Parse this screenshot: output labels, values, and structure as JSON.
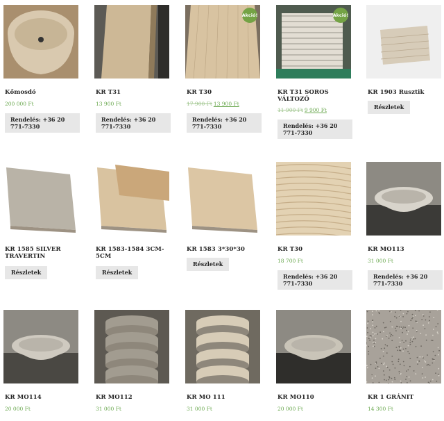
{
  "products": [
    {
      "title": "Kőmosdó",
      "price": "200 000 Ft",
      "old_price": "",
      "new_price": "",
      "badge": "",
      "button": "Rendelés: +36 20 771-7330",
      "button_type": "order",
      "img": "sink",
      "colors": [
        "#d9c9af",
        "#a98f6e"
      ]
    },
    {
      "title": "KR T31",
      "price": "13 900 Ft",
      "old_price": "",
      "new_price": "",
      "badge": "",
      "button": "Rendelés: +36 20 771-7330",
      "button_type": "order",
      "img": "slab-lean",
      "colors": [
        "#cdb896",
        "#8f7a5a"
      ]
    },
    {
      "title": "KR T30",
      "price": "",
      "old_price": "17 900 Ft",
      "new_price": "13 900 Ft",
      "badge": "Akció!",
      "button": "Rendelés: +36 20 771-7330",
      "button_type": "order",
      "img": "slab-flat",
      "colors": [
        "#d8c3a1",
        "#9c8464"
      ]
    },
    {
      "title": "KR T31 SOROS VÁLTOZÓ",
      "price": "",
      "old_price": "11 900 Ft",
      "new_price": "9 900 Ft",
      "badge": "Akció!",
      "button": "Rendelés: +36 20 771-7330",
      "button_type": "order",
      "img": "stack",
      "colors": [
        "#e2ddd3",
        "#7c7a72"
      ]
    },
    {
      "title": "KR 1903 Rusztik",
      "price": "",
      "old_price": "",
      "new_price": "",
      "badge": "",
      "button": "Részletek",
      "button_type": "details",
      "img": "rustic",
      "colors": [
        "#d7ccb9",
        "#efefef"
      ]
    },
    {
      "title": "KR 1585 SILVER TRAVERTIN",
      "price": "",
      "old_price": "",
      "new_price": "",
      "badge": "",
      "button": "Részletek",
      "button_type": "details",
      "img": "tile",
      "colors": [
        "#b9b3a7",
        "#ffffff"
      ]
    },
    {
      "title": "KR 1583-1584 3CM-5CM",
      "price": "",
      "old_price": "",
      "new_price": "",
      "badge": "",
      "button": "Részletek",
      "button_type": "details",
      "img": "tile2",
      "colors": [
        "#d9c3a0",
        "#ffffff"
      ]
    },
    {
      "title": "KR 1583 3*30*30",
      "price": "",
      "old_price": "",
      "new_price": "",
      "badge": "",
      "button": "Részletek",
      "button_type": "details",
      "img": "tile",
      "colors": [
        "#dcc6a4",
        "#ffffff"
      ]
    },
    {
      "title": "KR T30",
      "price": "18 700 Ft",
      "old_price": "",
      "new_price": "",
      "badge": "",
      "button": "Rendelés: +36 20 771-7330",
      "button_type": "order",
      "img": "vein",
      "colors": [
        "#e3d2b3",
        "#b99e78"
      ]
    },
    {
      "title": "KR MO113",
      "price": "31 000 Ft",
      "old_price": "",
      "new_price": "",
      "badge": "",
      "button": "Rendelés: +36 20 771-7330",
      "button_type": "order",
      "img": "bowl-dark",
      "colors": [
        "#d8d4cb",
        "#3b3a37"
      ]
    },
    {
      "title": "KR MO114",
      "price": "20 000 Ft",
      "old_price": "",
      "new_price": "",
      "badge": "",
      "button": "",
      "button_type": "",
      "img": "bowl-dark",
      "colors": [
        "#cfcac0",
        "#4a4843"
      ]
    },
    {
      "title": "KR MO112",
      "price": "31 000 Ft",
      "old_price": "",
      "new_price": "",
      "badge": "",
      "button": "",
      "button_type": "",
      "img": "pillar",
      "colors": [
        "#a29c90",
        "#5d5952"
      ]
    },
    {
      "title": "KR MO 111",
      "price": "31 000 Ft",
      "old_price": "",
      "new_price": "",
      "badge": "",
      "button": "",
      "button_type": "",
      "img": "pillar",
      "colors": [
        "#d7ccb7",
        "#6f6a60"
      ]
    },
    {
      "title": "KR MO110",
      "price": "20 000 Ft",
      "old_price": "",
      "new_price": "",
      "badge": "",
      "button": "",
      "button_type": "",
      "img": "bowl-dark",
      "colors": [
        "#c9c4b8",
        "#2f2e2b"
      ]
    },
    {
      "title": "KR 1 GRÁNIT",
      "price": "14 300 Ft",
      "old_price": "",
      "new_price": "",
      "badge": "",
      "button": "",
      "button_type": "",
      "img": "granite",
      "colors": [
        "#a8a29a",
        "#6c6760"
      ]
    }
  ]
}
